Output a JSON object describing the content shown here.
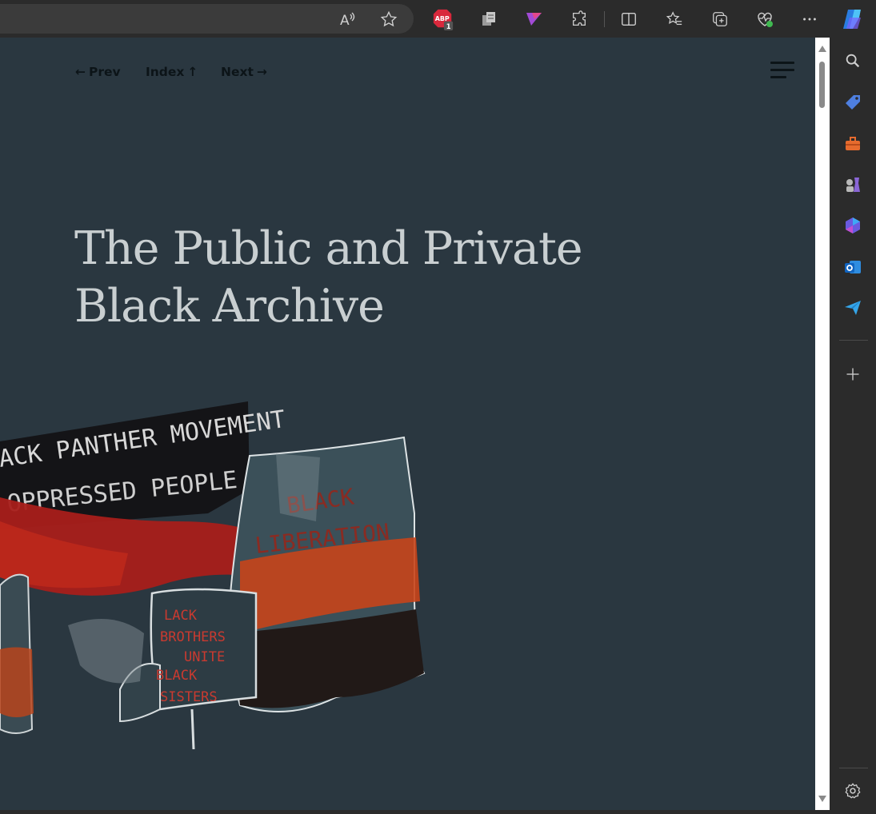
{
  "browser": {
    "toolbar_icons": [
      "read-aloud-icon",
      "favorite-star-icon",
      "adblock-extension-icon",
      "collections-extension-icon",
      "flag-extension-icon",
      "extensions-icon",
      "split-screen-icon",
      "favorites-icon",
      "collections-icon",
      "browser-health-icon",
      "more-icon",
      "copilot-icon"
    ],
    "adblock_badge": "1",
    "adblock_label": "ABP",
    "sidebar_icons": [
      "search-icon",
      "shopping-tag-icon",
      "tools-icon",
      "games-icon",
      "microsoft-365-icon",
      "outlook-icon",
      "send-icon",
      "add-icon",
      "settings-icon"
    ]
  },
  "nav": {
    "prev_label": "Prev",
    "prev_arrow": "←",
    "index_label": "Index",
    "index_arrow": "↑",
    "next_label": "Next",
    "next_arrow": "→"
  },
  "page": {
    "title_line1": "The Public and Private",
    "title_line2": "Black Archive",
    "background_color": "#2a3740",
    "title_color": "#c9cfd1"
  },
  "hero_image": {
    "banner_text_top": "ACK PANTHER MOVEMENT",
    "banner_text_bottom": "OPPRESSED PEOPLE",
    "sign_text": [
      "LACK",
      "BROTHERS",
      "UNITE",
      "BLACK",
      "SISTERS"
    ]
  }
}
